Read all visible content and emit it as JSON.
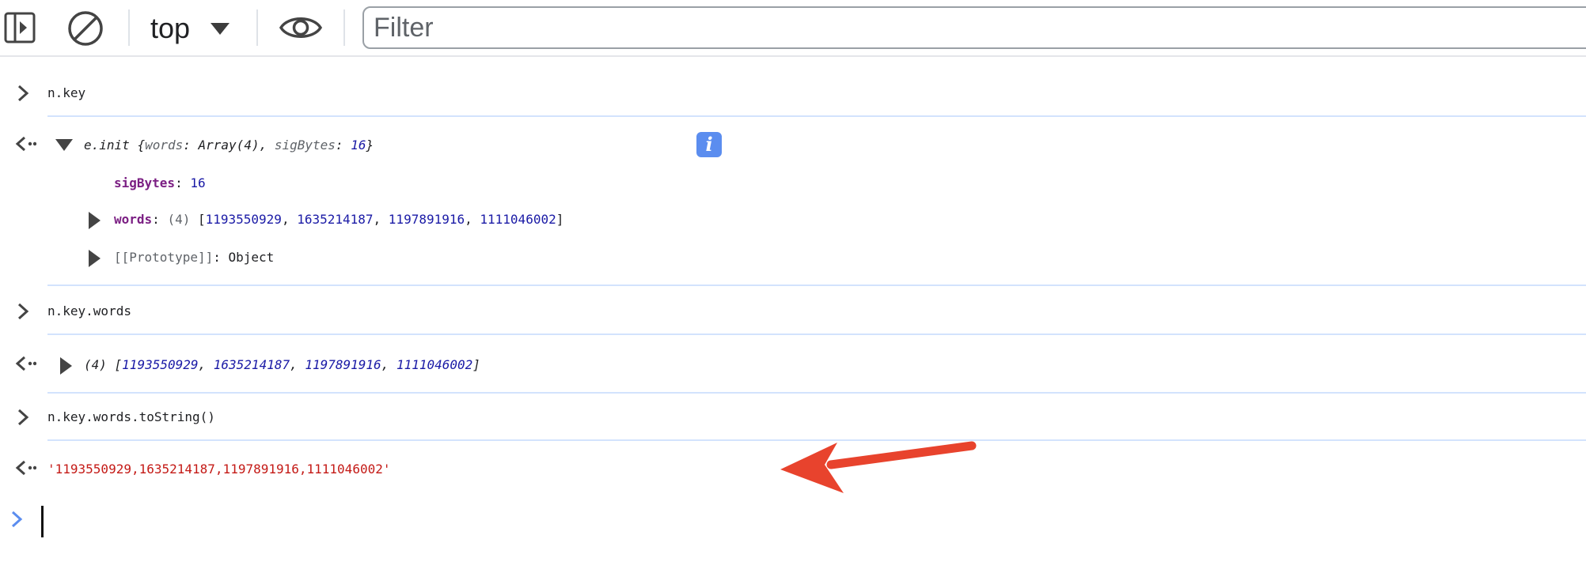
{
  "toolbar": {
    "context_label": "top",
    "filter_placeholder": "Filter"
  },
  "console": {
    "entries": [
      {
        "kind": "input",
        "text": "n.key"
      },
      {
        "kind": "output",
        "summary": {
          "class_name": "e.init",
          "open": "{",
          "words_key": "words",
          "words_value": "Array(4)",
          "comma": ",",
          "sigbytes_key": "sigBytes",
          "sigbytes_value": "16",
          "close": "}",
          "info_badge": "i"
        },
        "props": [
          {
            "key": "sigBytes",
            "value": "16"
          },
          {
            "key": "words",
            "prefix": "(4)",
            "values": [
              "1193550929",
              "1635214187",
              "1197891916",
              "1111046002"
            ]
          },
          {
            "key": "[[Prototype]]",
            "value": "Object"
          }
        ]
      },
      {
        "kind": "input",
        "text": "n.key.words"
      },
      {
        "kind": "output",
        "prefix": "(4)",
        "values": [
          "1193550929",
          "1635214187",
          "1197891916",
          "1111046002"
        ]
      },
      {
        "kind": "input",
        "text": "n.key.words.toString()"
      },
      {
        "kind": "output",
        "string_value": "'1193550929,1635214187,1197891916,1111046002'"
      }
    ]
  },
  "colors": {
    "string": "#c41a16",
    "number": "#1a1aa6",
    "property_key": "#7b1f83",
    "arrow_annotation": "#e8432d",
    "prompt_active": "#5b8def"
  }
}
